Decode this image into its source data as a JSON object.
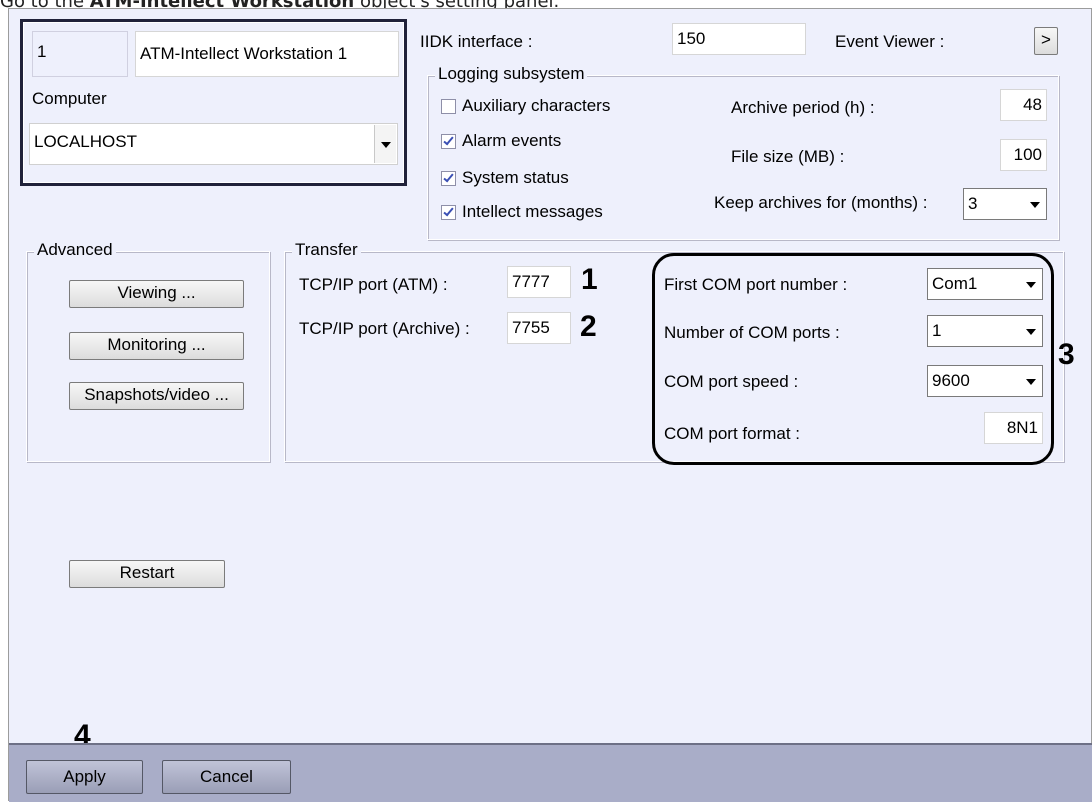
{
  "intro": {
    "prefix": "Go to the ",
    "bold": "ATM-Intellect Workstation",
    "suffix": " object's setting panel."
  },
  "object": {
    "id": "1",
    "name": "ATM-Intellect Workstation 1",
    "computer_label": "Computer",
    "computer_value": "LOCALHOST"
  },
  "iidk": {
    "label": "IIDK interface :",
    "value": "150"
  },
  "event_viewer": {
    "label": "Event Viewer :",
    "button": ">"
  },
  "logging": {
    "title": "Logging subsystem",
    "checkboxes": [
      {
        "label": "Auxiliary characters",
        "checked": false
      },
      {
        "label": "Alarm events",
        "checked": true
      },
      {
        "label": "System status",
        "checked": true
      },
      {
        "label": "Intellect messages",
        "checked": true
      }
    ],
    "archive_period_label": "Archive period (h) :",
    "archive_period_value": "48",
    "file_size_label": "File size (MB) :",
    "file_size_value": "100",
    "keep_label": "Keep archives for (months) :",
    "keep_value": "3"
  },
  "advanced": {
    "title": "Advanced",
    "viewing": "Viewing ...",
    "monitoring": "Monitoring ...",
    "snapshots": "Snapshots/video ..."
  },
  "transfer": {
    "title": "Transfer",
    "atm_label": "TCP/IP port (ATM) :",
    "atm_value": "7777",
    "archive_label": "TCP/IP port (Archive) :",
    "archive_value": "7755",
    "first_com_label": "First COM port number :",
    "first_com_value": "Com1",
    "num_com_label": "Number of COM ports :",
    "num_com_value": "1",
    "speed_label": "COM port speed :",
    "speed_value": "9600",
    "format_label": "COM port format :",
    "format_value": "8N1"
  },
  "restart": "Restart",
  "callouts": {
    "one": "1",
    "two": "2",
    "three": "3",
    "four": "4"
  },
  "buttons": {
    "apply": "Apply",
    "cancel": "Cancel"
  },
  "colors": {
    "panel_bg": "#eef0fc",
    "bottom_bar": "#a9adc8",
    "check_mark": "#3a4fb4"
  }
}
